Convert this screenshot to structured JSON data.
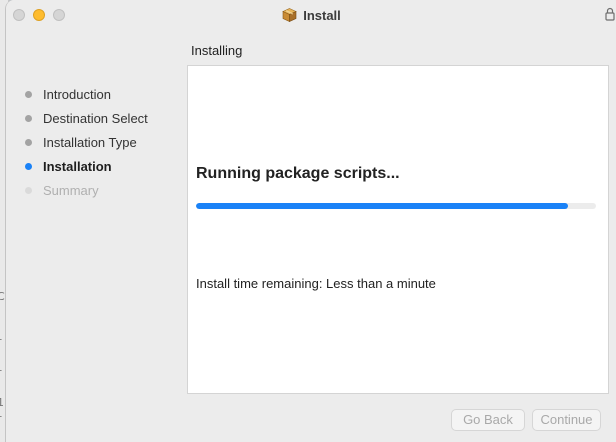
{
  "window": {
    "title": "Install"
  },
  "sidebar": {
    "steps": [
      {
        "label": "Introduction",
        "state": "done"
      },
      {
        "label": "Destination Select",
        "state": "done"
      },
      {
        "label": "Installation Type",
        "state": "done"
      },
      {
        "label": "Installation",
        "state": "active"
      },
      {
        "label": "Summary",
        "state": "pending"
      }
    ]
  },
  "main": {
    "heading": "Installing",
    "status": "Running package scripts...",
    "progress_fraction": 0.93,
    "time_remaining": "Install time remaining: Less than a minute"
  },
  "buttons": {
    "back": "Go Back",
    "continue": "Continue"
  },
  "colors": {
    "accent": "#1a82f7",
    "minimize": "#febc2e"
  },
  "icons": {
    "title": "package-icon",
    "lock": "lock-icon"
  }
}
